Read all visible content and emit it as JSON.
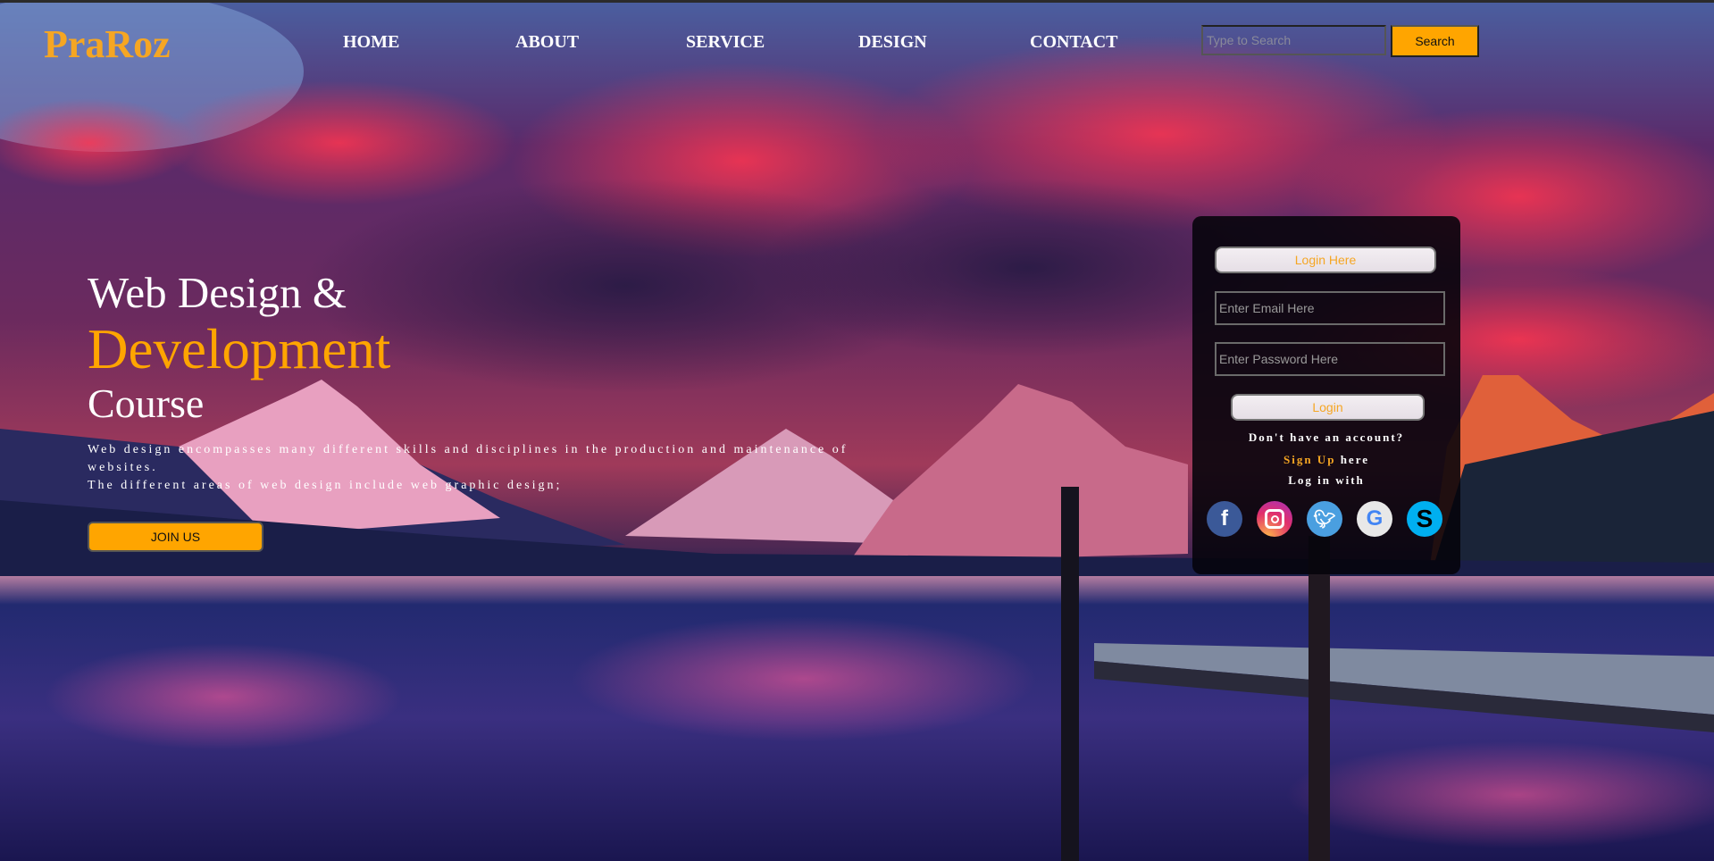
{
  "header": {
    "logo": "PraRoz",
    "nav": [
      "HOME",
      "ABOUT",
      "SERVICE",
      "DESIGN",
      "CONTACT"
    ],
    "search_placeholder": "Type to Search",
    "search_button": "Search"
  },
  "hero": {
    "line1": "Web Design &",
    "line2": "Development",
    "line3": "Course",
    "desc1": "Web design encompasses many different skills and disciplines in the production and maintenance of websites.",
    "desc2": "The different areas of web design include web graphic design;",
    "join_button": "JOIN US"
  },
  "login": {
    "title": "Login Here",
    "email_placeholder": "Enter Email Here",
    "password_placeholder": "Enter Password Here",
    "login_button": "Login",
    "no_account": "Don't have an account?",
    "signup_link": "Sign Up",
    "signup_suffix": " here",
    "login_with": "Log in with",
    "socials": [
      "facebook",
      "instagram",
      "twitter",
      "google",
      "skype"
    ]
  },
  "colors": {
    "accent": "#ffa500",
    "logo": "#f5a623"
  }
}
